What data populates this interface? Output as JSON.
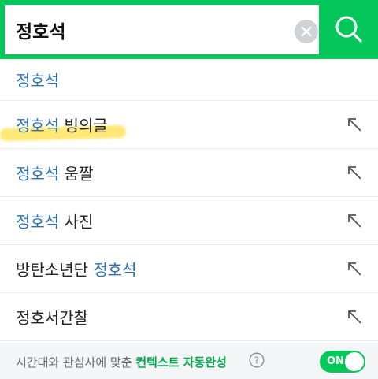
{
  "search": {
    "value": "정호석"
  },
  "suggestions": [
    {
      "hl_prefix": "",
      "hl": "정호석",
      "rest": ""
    },
    {
      "hl_prefix": "",
      "hl": "정호석",
      "rest": " 빙의글"
    },
    {
      "hl_prefix": "",
      "hl": "정호석",
      "rest": " 움짤"
    },
    {
      "hl_prefix": "",
      "hl": "정호석",
      "rest": " 사진"
    },
    {
      "hl_prefix": "방탄소년단 ",
      "hl": "정호석",
      "rest": ""
    },
    {
      "hl_prefix": "정호서간찰",
      "hl": "",
      "rest": ""
    }
  ],
  "footer": {
    "text": "시간대와 관심사에 맞춘 ",
    "highlight": "컨텍스트 자동완성",
    "toggle_label": "ON"
  },
  "colors": {
    "accent": "#03c75a",
    "highlight_text": "#2c6fb8"
  },
  "icons": {
    "clear": "clear-icon",
    "search": "search-icon",
    "insert": "arrow-up-left-icon",
    "help": "help-icon"
  }
}
